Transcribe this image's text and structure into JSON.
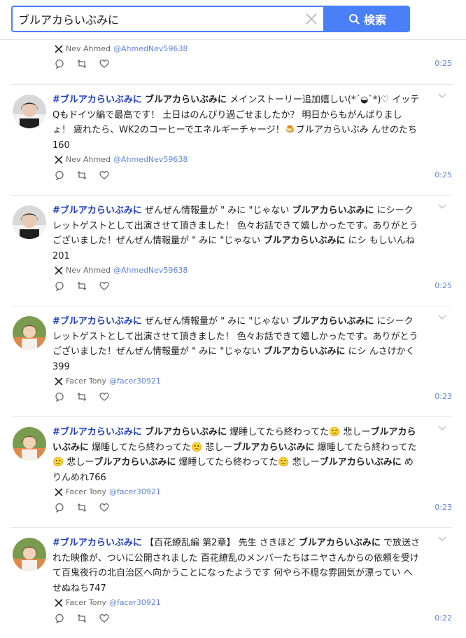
{
  "search": {
    "value": "ブルアカらいぶみに",
    "button_label": "検索"
  },
  "posts": [
    {
      "author": "Nev Ahmed",
      "handle": "@AhmedNev59638",
      "time": "0:25",
      "segments": []
    },
    {
      "author": "Nev Ahmed",
      "handle": "@AhmedNev59638",
      "time": "0:25",
      "segments": [
        {
          "t": "#ブルアカらいぶみに",
          "s": "tag"
        },
        {
          "t": " "
        },
        {
          "t": "ブルアカらいぶみに",
          "s": "kw"
        },
        {
          "t": " メインストーリー追加嬉しい(*´◒`*)♡ イッテQもドイツ編で最高です！ 土日はのんびり過ごせましたか？ 明日からもがんばりましょ！ 疲れたら、WK2のコーヒーでエネルギーチャージ！🍮ブルアカらいぶみ んせのたち160"
        }
      ]
    },
    {
      "author": "Nev Ahmed",
      "handle": "@AhmedNev59638",
      "time": "0:25",
      "segments": [
        {
          "t": "#ブルアカらいぶみに",
          "s": "tag"
        },
        {
          "t": " ぜんぜん情報量が \" みに \"じゃない "
        },
        {
          "t": "ブルアカらいぶみに",
          "s": "kw"
        },
        {
          "t": " にシークレットゲストとして出演させて頂きました！ 色々お話できて嬉しかったです。ありがとうございました！ぜんぜん情報量が \" みに \"じゃない "
        },
        {
          "t": "ブルアカらいぶみに",
          "s": "kw"
        },
        {
          "t": " にシ もしいんね201"
        }
      ]
    },
    {
      "author": "Facer Tony",
      "handle": "@facer30921",
      "time": "0:23",
      "segments": [
        {
          "t": "#ブルアカらいぶみに",
          "s": "tag"
        },
        {
          "t": " ぜんぜん情報量が \" みに \"じゃない "
        },
        {
          "t": "ブルアカらいぶみに",
          "s": "kw"
        },
        {
          "t": " にシークレットゲストとして出演させて頂きました！ 色々お話できて嬉しかったです。ありがとうございました！ぜんぜん情報量が \" みに \"じゃない "
        },
        {
          "t": "ブルアカらいぶみに",
          "s": "kw"
        },
        {
          "t": " にシ んさけかく399"
        }
      ]
    },
    {
      "author": "Facer Tony",
      "handle": "@facer30921",
      "time": "0:23",
      "segments": [
        {
          "t": "#ブルアカらいぶみに",
          "s": "tag"
        },
        {
          "t": " "
        },
        {
          "t": "ブルアカらいぶみに",
          "s": "kw"
        },
        {
          "t": " 爆睡してたら終わってた🙁 悲しー"
        },
        {
          "t": "ブルアカらいぶみに",
          "s": "kw"
        },
        {
          "t": " 爆睡してたら終わってた🙁 悲しー"
        },
        {
          "t": "ブルアカらいぶみに",
          "s": "kw"
        },
        {
          "t": " 爆睡してたら終わってた🙁 悲しー"
        },
        {
          "t": "ブルアカらいぶみに",
          "s": "kw"
        },
        {
          "t": " 爆睡してたら終わってた🙁 悲しー"
        },
        {
          "t": "ブルアカらいぶみに",
          "s": "kw"
        },
        {
          "t": " めりんめれ766"
        }
      ]
    },
    {
      "author": "Facer Tony",
      "handle": "@facer30921",
      "time": "0:22",
      "segments": [
        {
          "t": "#ブルアカらいぶみに",
          "s": "tag"
        },
        {
          "t": " 【百花繚乱編 第2章】 先生 さきほど "
        },
        {
          "t": "ブルアカらいぶみに",
          "s": "kw"
        },
        {
          "t": " で放送された映像が、ついに公開されました 百花繚乱のメンバーたちはニヤさんからの依頼を受けて百鬼夜行の北自治区へ向かうことになったようです 何やら不穏な雰囲気が漂ってい へせぬねち747"
        }
      ]
    }
  ]
}
